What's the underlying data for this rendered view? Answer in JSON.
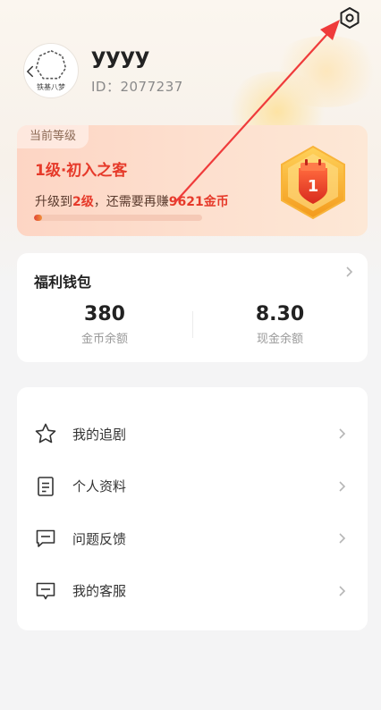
{
  "profile": {
    "avatar_caption": "铁基八梦",
    "username": "yyyy",
    "id_label": "ID：2077237"
  },
  "settings": {
    "icon": "settings-gear-icon"
  },
  "level": {
    "tag": "当前等级",
    "name": "1级·初入之客",
    "upgrade_prefix": "升级到",
    "upgrade_target": "2级",
    "upgrade_middle": "，还需要再赚",
    "upgrade_amount": "9621金币",
    "progress_fraction": 0.05,
    "badge_number": "1"
  },
  "wallet": {
    "title": "福利钱包",
    "coins_value": "380",
    "coins_label": "金币余额",
    "cash_value": "8.30",
    "cash_label": "现金余额"
  },
  "menu": {
    "items": [
      {
        "label": "我的追剧",
        "icon": "star-icon"
      },
      {
        "label": "个人资料",
        "icon": "document-icon"
      },
      {
        "label": "问题反馈",
        "icon": "feedback-icon"
      },
      {
        "label": "我的客服",
        "icon": "customer-service-icon"
      }
    ]
  },
  "colors": {
    "accent_red": "#e63a2a",
    "annotation_arrow": "#ef3b3b"
  }
}
